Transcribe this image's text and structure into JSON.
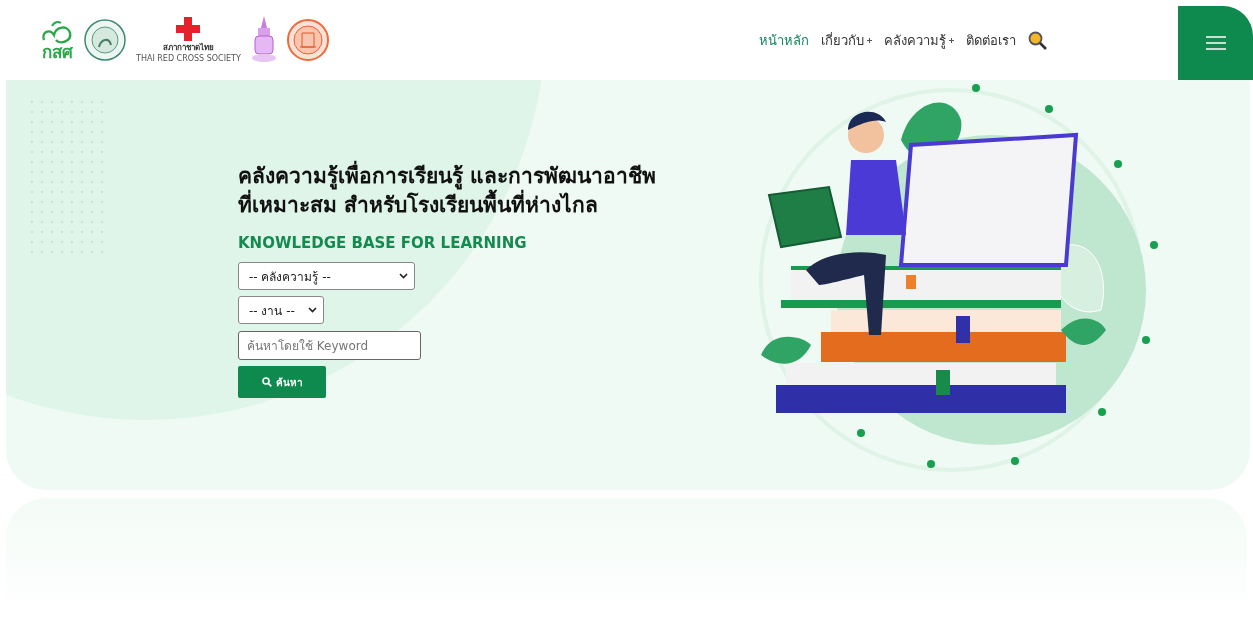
{
  "logos": {
    "primary_text": "กสศ",
    "red_cross_text": "สภากาชาดไทย",
    "red_cross_subtext": "THAI RED CROSS SOCIETY"
  },
  "nav": [
    {
      "label": "หน้าหลัก",
      "selected": true,
      "has_submenu": false
    },
    {
      "label": "เกี่ยวกับ",
      "selected": false,
      "has_submenu": true
    },
    {
      "label": "คลังความรู้",
      "selected": false,
      "has_submenu": true
    },
    {
      "label": "ติดต่อเรา",
      "selected": false,
      "has_submenu": false
    }
  ],
  "hero": {
    "title_lines": [
      "คลังความรู้เพื่อการเรียนรู้ และการพัฒนาอาชีพ",
      "ที่เหมาะสม สำหรับโรงเรียนพื้นที่ห่างไกล"
    ],
    "subtitle": "KNOWLEDGE BASE FOR LEARNING",
    "filters": [
      {
        "value": "-- คลังความรู้ --",
        "kind": "wide"
      },
      {
        "value": "-- งาน --",
        "kind": "narrow"
      }
    ],
    "search": {
      "placeholder": "ค้นหาโดยใช้ Keyword"
    },
    "button": "ค้นหา"
  }
}
